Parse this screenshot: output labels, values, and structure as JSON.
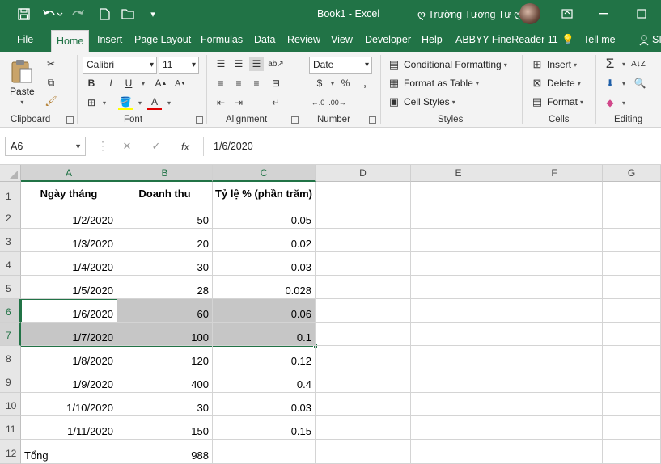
{
  "title_bar": {
    "title": "Book1  -  Excel",
    "user_name": "ღ Trường Tương Tư ღ"
  },
  "tabs": [
    "File",
    "Home",
    "Insert",
    "Page Layout",
    "Formulas",
    "Data",
    "Review",
    "View",
    "Developer",
    "Help",
    "ABBYY FineReader 11",
    "Tell me",
    "SI"
  ],
  "active_tab": "Home",
  "ribbon": {
    "clipboard": {
      "label": "Clipboard",
      "paste": "Paste"
    },
    "font": {
      "label": "Font",
      "font_name": "Calibri",
      "font_size": "11",
      "bold": "B",
      "italic": "I",
      "underline": "U"
    },
    "alignment": {
      "label": "Alignment"
    },
    "number": {
      "label": "Number",
      "format": "Date"
    },
    "styles": {
      "label": "Styles",
      "conditional": "Conditional Formatting",
      "format_table": "Format as Table",
      "cell_styles": "Cell Styles"
    },
    "cells": {
      "label": "Cells",
      "insert": "Insert",
      "delete": "Delete",
      "format": "Format"
    },
    "editing": {
      "label": "Editing"
    }
  },
  "formula_bar": {
    "name_box": "A6",
    "formula": "1/6/2020"
  },
  "columns": [
    "A",
    "B",
    "C",
    "D",
    "E",
    "F",
    "G"
  ],
  "selected_columns": [
    "A",
    "B",
    "C"
  ],
  "selected_rows": [
    "6",
    "7"
  ],
  "rows": [
    {
      "num": "1",
      "a": "Ngày tháng",
      "b": "Doanh thu",
      "c": "Tỷ lệ % (phần trăm)",
      "header": true
    },
    {
      "num": "2",
      "a": "1/2/2020",
      "b": "50",
      "c": "0.05"
    },
    {
      "num": "3",
      "a": "1/3/2020",
      "b": "20",
      "c": "0.02"
    },
    {
      "num": "4",
      "a": "1/4/2020",
      "b": "30",
      "c": "0.03"
    },
    {
      "num": "5",
      "a": "1/5/2020",
      "b": "28",
      "c": "0.028"
    },
    {
      "num": "6",
      "a": "1/6/2020",
      "b": "60",
      "c": "0.06"
    },
    {
      "num": "7",
      "a": "1/7/2020",
      "b": "100",
      "c": "0.1"
    },
    {
      "num": "8",
      "a": "1/8/2020",
      "b": "120",
      "c": "0.12"
    },
    {
      "num": "9",
      "a": "1/9/2020",
      "b": "400",
      "c": "0.4"
    },
    {
      "num": "10",
      "a": "1/10/2020",
      "b": "30",
      "c": "0.03"
    },
    {
      "num": "11",
      "a": "1/11/2020",
      "b": "150",
      "c": "0.15"
    },
    {
      "num": "12",
      "a": "Tổng",
      "b": "988",
      "c": ""
    }
  ],
  "colors": {
    "excel_green": "#217346",
    "selection_fill": "#c6c6c6"
  }
}
